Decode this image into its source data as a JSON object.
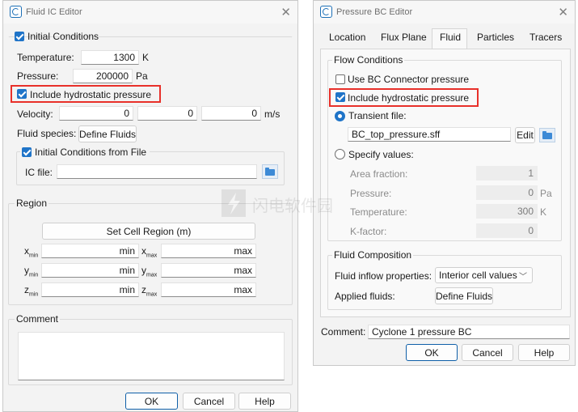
{
  "ic_editor": {
    "title": "Fluid IC Editor",
    "initial_conditions": {
      "label": "Initial Conditions",
      "checked": true
    },
    "temperature": {
      "label": "Temperature:",
      "value": "1300",
      "unit": "K"
    },
    "pressure": {
      "label": "Pressure:",
      "value": "200000",
      "unit": "Pa"
    },
    "hydrostatic": {
      "label": "Include hydrostatic pressure",
      "checked": true
    },
    "velocity": {
      "label": "Velocity:",
      "values": [
        "0",
        "0",
        "0"
      ],
      "unit": "m/s"
    },
    "fluid_species": {
      "label": "Fluid species:",
      "button": "Define Fluids"
    },
    "from_file": {
      "label": "Initial Conditions from File",
      "checked": true
    },
    "ic_file": {
      "label": "IC file:",
      "value": ""
    },
    "region": {
      "label": "Region",
      "set_button": "Set Cell Region (m)",
      "x": {
        "min_label": "x",
        "min_sub": "min",
        "max_label": "x",
        "max_sub": "max",
        "min_value": "min",
        "max_value": "max"
      },
      "y": {
        "min_label": "y",
        "min_sub": "min",
        "max_label": "y",
        "max_sub": "max",
        "min_value": "min",
        "max_value": "max"
      },
      "z": {
        "min_label": "z",
        "min_sub": "min",
        "max_label": "z",
        "max_sub": "max",
        "min_value": "min",
        "max_value": "max"
      }
    },
    "comment": {
      "label": "Comment",
      "value": ""
    },
    "buttons": {
      "ok": "OK",
      "cancel": "Cancel",
      "help": "Help"
    }
  },
  "bc_editor": {
    "title": "Pressure BC Editor",
    "tabs": [
      "Location",
      "Flux Plane",
      "Fluid",
      "Particles",
      "Tracers"
    ],
    "active_tab": "Fluid",
    "flow_conditions": {
      "label": "Flow Conditions",
      "bc_connector": {
        "label": "Use BC Connector pressure",
        "checked": false
      },
      "hydrostatic": {
        "label": "Include hydrostatic pressure",
        "checked": true
      },
      "transient": {
        "label": "Transient file:",
        "selected": true,
        "file": "BC_top_pressure.sff",
        "edit": "Edit"
      },
      "specify": {
        "label": "Specify values:",
        "selected": false
      },
      "area_fraction": {
        "label": "Area fraction:",
        "value": "1",
        "unit": ""
      },
      "pressure": {
        "label": "Pressure:",
        "value": "0",
        "unit": "Pa"
      },
      "temperature": {
        "label": "Temperature:",
        "value": "300",
        "unit": "K"
      },
      "k_factor": {
        "label": "K-factor:",
        "value": "0",
        "unit": ""
      }
    },
    "fluid_composition": {
      "label": "Fluid Composition",
      "inflow": {
        "label": "Fluid inflow properties:",
        "value": "Interior cell values"
      },
      "applied": {
        "label": "Applied fluids:",
        "button": "Define Fluids"
      }
    },
    "comment": {
      "label": "Comment:",
      "value": "Cyclone 1 pressure BC"
    },
    "buttons": {
      "ok": "OK",
      "cancel": "Cancel",
      "help": "Help"
    }
  },
  "watermark": {
    "text": "闪电软件园"
  },
  "colors": {
    "accent": "#1f74c8",
    "highlight": "#e8302a",
    "dialog_bg": "#f3f3f3"
  }
}
